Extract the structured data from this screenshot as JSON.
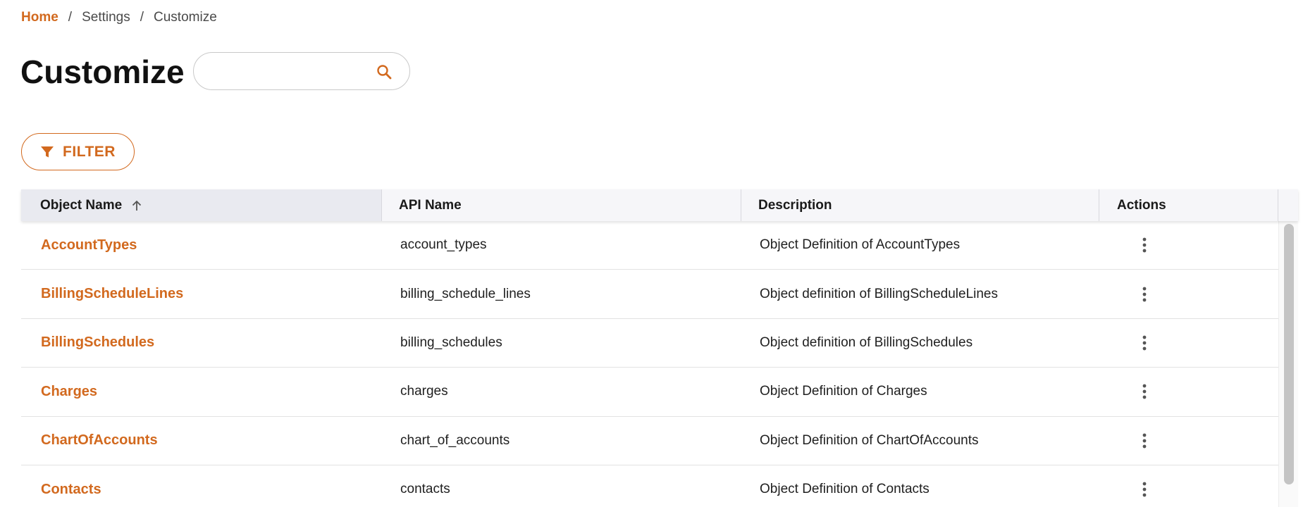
{
  "breadcrumb": {
    "home": "Home",
    "separator": "/",
    "settings": "Settings",
    "current": "Customize"
  },
  "page": {
    "title": "Customize"
  },
  "search": {
    "placeholder": "",
    "value": "",
    "icon": "search-icon"
  },
  "filter": {
    "label": "FILTER",
    "icon": "filter-icon"
  },
  "colors": {
    "accent": "#d2691e",
    "header_bg": "#f6f6f9",
    "sorted_header_bg": "#e9eaf0"
  },
  "table": {
    "columns": [
      {
        "label": "Object Name",
        "sort": "ascending"
      },
      {
        "label": "API Name"
      },
      {
        "label": "Description"
      },
      {
        "label": "Actions"
      }
    ],
    "rows": [
      {
        "object_name": "AccountTypes",
        "api_name": "account_types",
        "description": "Object Definition of AccountTypes"
      },
      {
        "object_name": "BillingScheduleLines",
        "api_name": "billing_schedule_lines",
        "description": "Object definition of BillingScheduleLines"
      },
      {
        "object_name": "BillingSchedules",
        "api_name": "billing_schedules",
        "description": "Object definition of BillingSchedules"
      },
      {
        "object_name": "Charges",
        "api_name": "charges",
        "description": "Object Definition of Charges"
      },
      {
        "object_name": "ChartOfAccounts",
        "api_name": "chart_of_accounts",
        "description": "Object Definition of ChartOfAccounts"
      },
      {
        "object_name": "Contacts",
        "api_name": "contacts",
        "description": "Object Definition of Contacts"
      }
    ]
  }
}
